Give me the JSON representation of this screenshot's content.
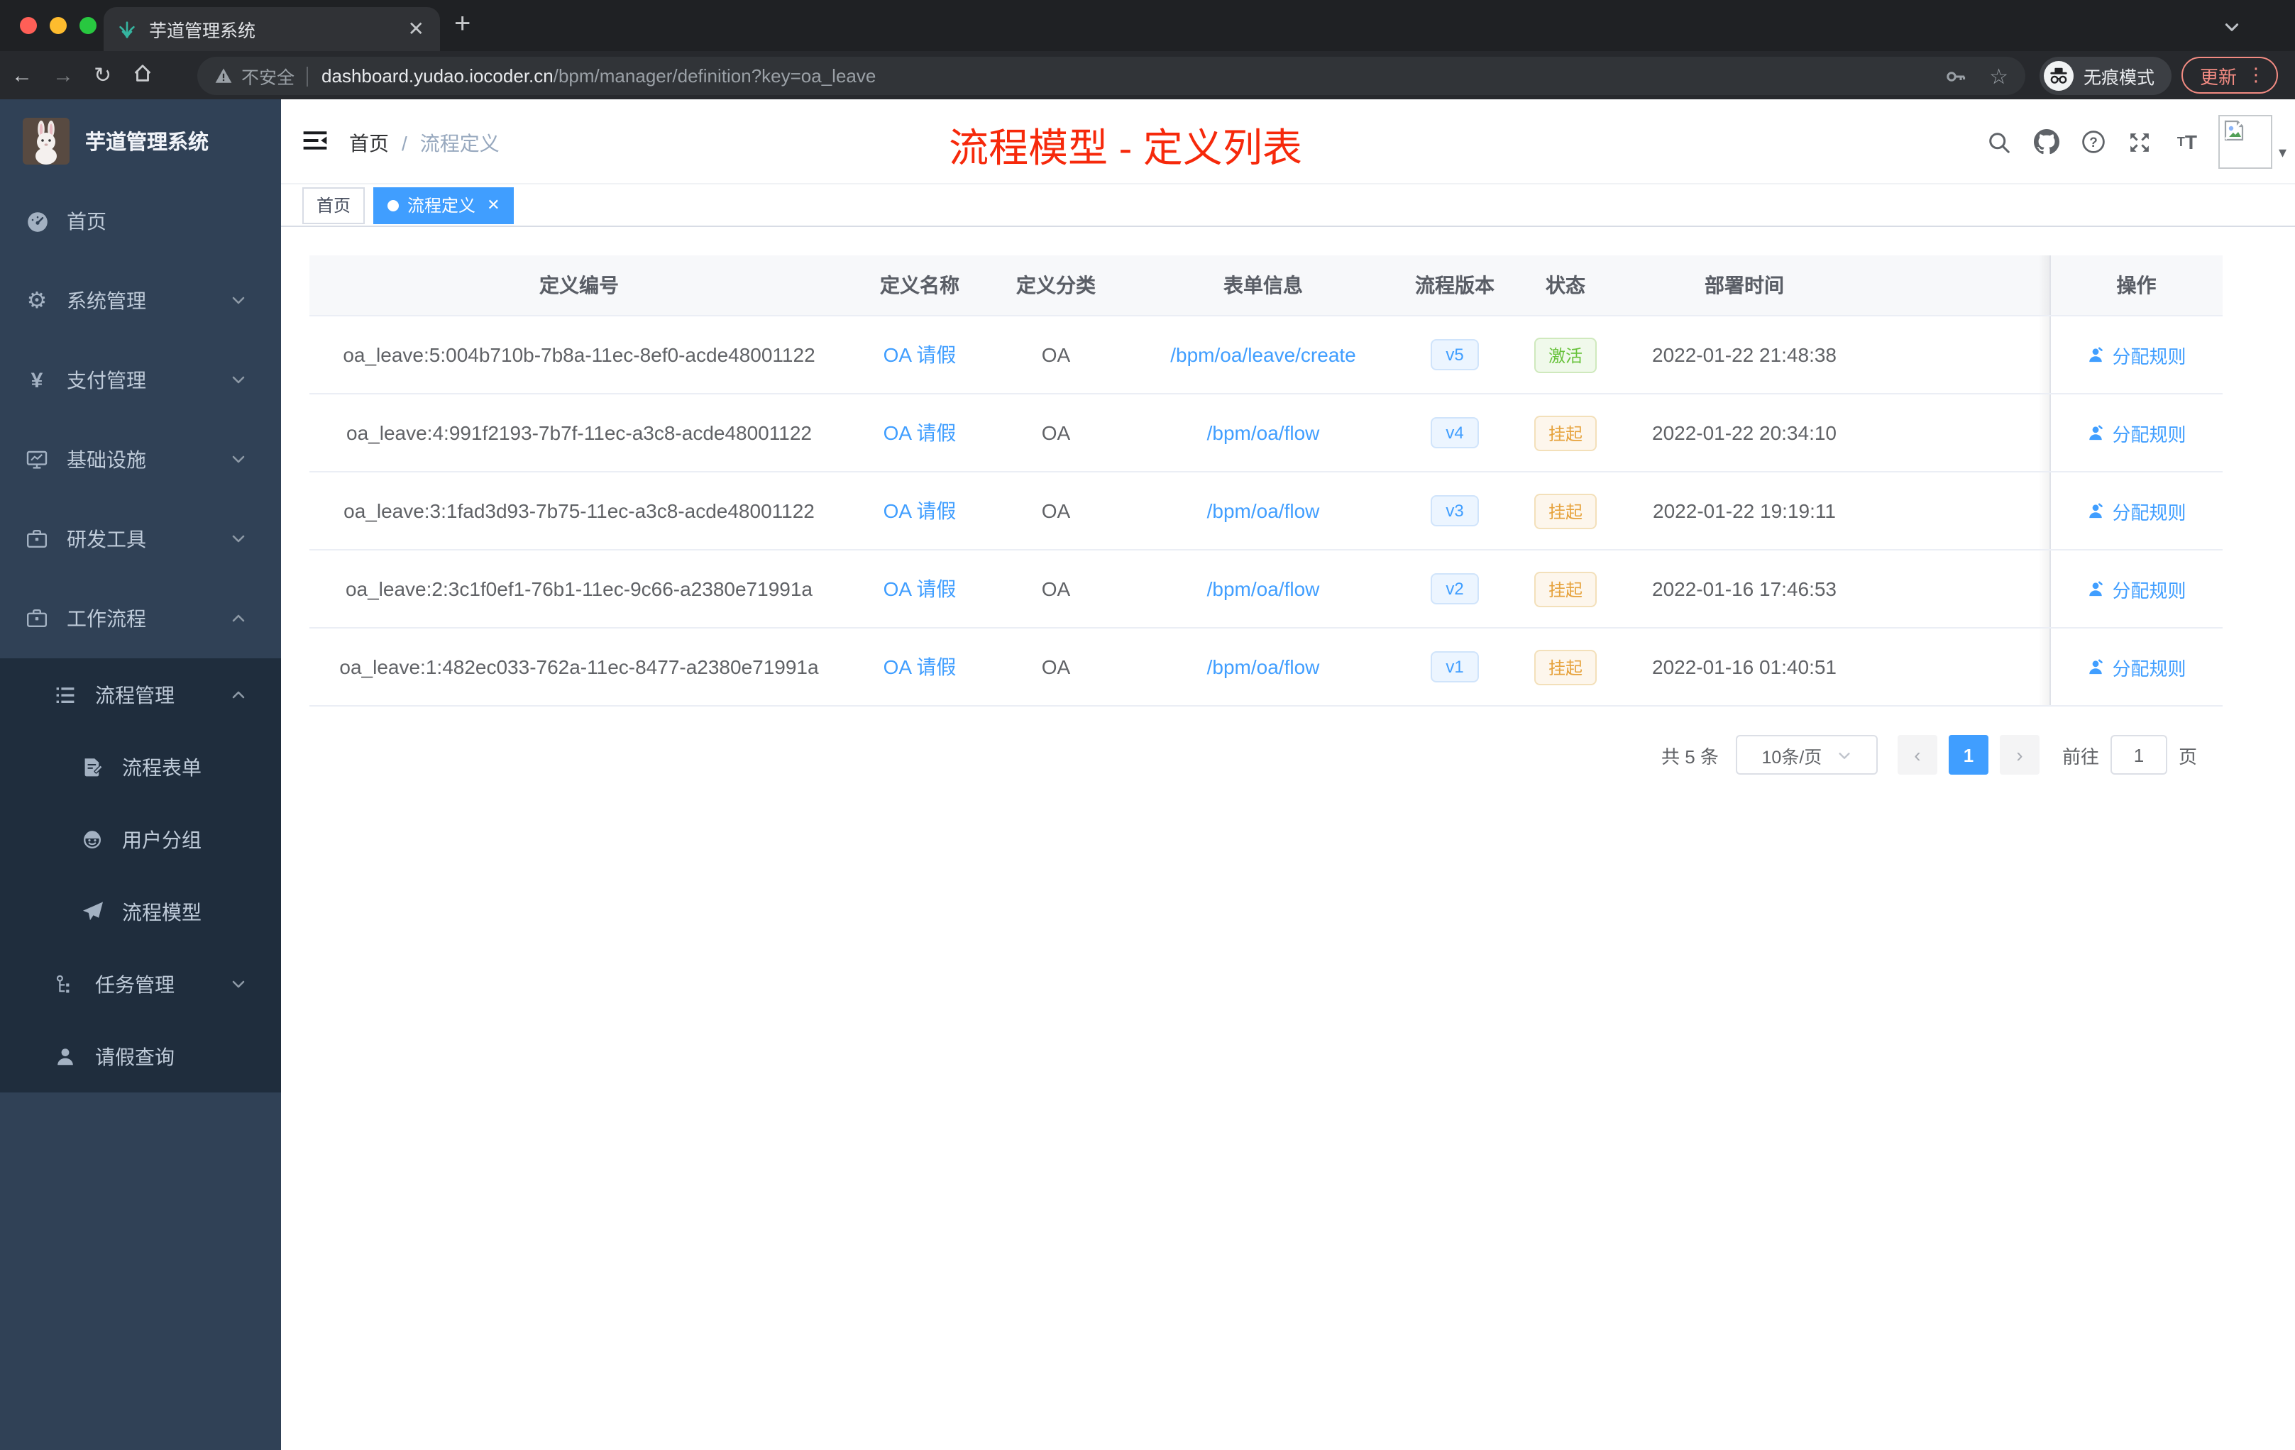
{
  "colors": {
    "accent": "#409eff",
    "banner_red": "#f6290b",
    "success": "#67c23a",
    "warning": "#e6a23c",
    "sidebar_bg": "#304156",
    "submenu_bg": "#1f2d3d",
    "traffic": [
      "#ff5f57",
      "#febc2e",
      "#28c840"
    ]
  },
  "browser": {
    "tab_title": "芋道管理系统",
    "security_label": "不安全",
    "url_host": "dashboard.yudao.iocoder.cn",
    "url_path": "/bpm/manager/definition?key=oa_leave",
    "incognito_label": "无痕模式",
    "update_label": "更新"
  },
  "sidebar": {
    "app_title": "芋道管理系统",
    "items": [
      {
        "icon": "dashboard",
        "label": "首页",
        "level": 1,
        "chevron": "none",
        "sub": false
      },
      {
        "icon": "gear",
        "label": "系统管理",
        "level": 1,
        "chevron": "down",
        "sub": false
      },
      {
        "icon": "yen",
        "label": "支付管理",
        "level": 1,
        "chevron": "down",
        "sub": false
      },
      {
        "icon": "monitor",
        "label": "基础设施",
        "level": 1,
        "chevron": "down",
        "sub": false
      },
      {
        "icon": "briefcase",
        "label": "研发工具",
        "level": 1,
        "chevron": "down",
        "sub": false
      },
      {
        "icon": "briefcase",
        "label": "工作流程",
        "level": 1,
        "chevron": "up",
        "sub": false
      },
      {
        "icon": "listtree",
        "label": "流程管理",
        "level": 2,
        "chevron": "up",
        "sub": true
      },
      {
        "icon": "docedit",
        "label": "流程表单",
        "level": 3,
        "chevron": "none",
        "sub": true
      },
      {
        "icon": "face",
        "label": "用户分组",
        "level": 3,
        "chevron": "none",
        "sub": true
      },
      {
        "icon": "plane",
        "label": "流程模型",
        "level": 3,
        "chevron": "none",
        "sub": true
      },
      {
        "icon": "tasktree",
        "label": "任务管理",
        "level": 2,
        "chevron": "down",
        "sub": true
      },
      {
        "icon": "person",
        "label": "请假查询",
        "level": 2,
        "chevron": "none",
        "sub": true
      }
    ]
  },
  "header": {
    "breadcrumb_home": "首页",
    "breadcrumb_sep": "/",
    "breadcrumb_current": "流程定义",
    "banner": "流程模型 - 定义列表"
  },
  "tags": [
    {
      "label": "首页",
      "active": false
    },
    {
      "label": "流程定义",
      "active": true
    }
  ],
  "table": {
    "columns": [
      "定义编号",
      "定义名称",
      "定义分类",
      "表单信息",
      "流程版本",
      "状态",
      "部署时间",
      "操作"
    ],
    "action_label": "分配规则",
    "rows": [
      {
        "id": "oa_leave:5:004b710b-7b8a-11ec-8ef0-acde48001122",
        "name": "OA 请假",
        "category": "OA",
        "form": "/bpm/oa/leave/create",
        "version": "v5",
        "status": "激活",
        "status_type": "success",
        "time": "2022-01-22 21:48:38"
      },
      {
        "id": "oa_leave:4:991f2193-7b7f-11ec-a3c8-acde48001122",
        "name": "OA 请假",
        "category": "OA",
        "form": "/bpm/oa/flow",
        "version": "v4",
        "status": "挂起",
        "status_type": "warning",
        "time": "2022-01-22 20:34:10"
      },
      {
        "id": "oa_leave:3:1fad3d93-7b75-11ec-a3c8-acde48001122",
        "name": "OA 请假",
        "category": "OA",
        "form": "/bpm/oa/flow",
        "version": "v3",
        "status": "挂起",
        "status_type": "warning",
        "time": "2022-01-22 19:19:11"
      },
      {
        "id": "oa_leave:2:3c1f0ef1-76b1-11ec-9c66-a2380e71991a",
        "name": "OA 请假",
        "category": "OA",
        "form": "/bpm/oa/flow",
        "version": "v2",
        "status": "挂起",
        "status_type": "warning",
        "time": "2022-01-16 17:46:53"
      },
      {
        "id": "oa_leave:1:482ec033-762a-11ec-8477-a2380e71991a",
        "name": "OA 请假",
        "category": "OA",
        "form": "/bpm/oa/flow",
        "version": "v1",
        "status": "挂起",
        "status_type": "warning",
        "time": "2022-01-16 01:40:51"
      }
    ]
  },
  "pagination": {
    "total": "共 5 条",
    "page_size": "10条/页",
    "current": "1",
    "goto_label": "前往",
    "goto_value": "1",
    "page_unit": "页"
  }
}
